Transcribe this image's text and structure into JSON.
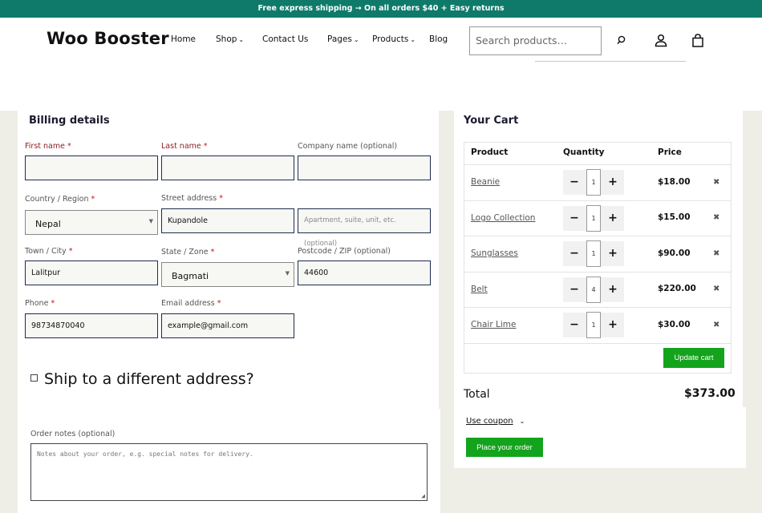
{
  "topbar": {
    "text": "Free express shipping → On all orders $40 + Easy returns"
  },
  "header": {
    "logo": "Woo Booster",
    "nav": [
      {
        "label": "Home",
        "dropdown": false
      },
      {
        "label": "Shop",
        "dropdown": true
      },
      {
        "label": "Contact Us",
        "dropdown": false
      },
      {
        "label": "Pages",
        "dropdown": true
      },
      {
        "label": "Products",
        "dropdown": true
      },
      {
        "label": "Blog",
        "dropdown": false
      }
    ],
    "search_placeholder": "Search products…",
    "icons": [
      "search-icon",
      "user-icon",
      "shopping-bag-icon"
    ]
  },
  "billing": {
    "title": "Billing details",
    "first_name": {
      "label": "First name",
      "value": ""
    },
    "last_name": {
      "label": "Last name",
      "value": ""
    },
    "company": {
      "label": "Company name (optional)",
      "value": ""
    },
    "country": {
      "label": "Country / Region",
      "value": "Nepal"
    },
    "street": {
      "label": "Street address",
      "value": "Kupandole",
      "placeholder2": "Apartment, suite, unit, etc. (optional)"
    },
    "town": {
      "label": "Town / City",
      "value": "Lalitpur"
    },
    "state": {
      "label": "State / Zone",
      "value": "Bagmati"
    },
    "postcode": {
      "label": "Postcode / ZIP (optional)",
      "value": "44600"
    },
    "phone": {
      "label": "Phone",
      "value": "98734870040"
    },
    "email": {
      "label": "Email address",
      "value": "example@gmail.com"
    },
    "required_mark": "*",
    "ship_different": "Ship to a different address?",
    "order_notes": {
      "label": "Order notes (optional)",
      "placeholder": "Notes about your order, e.g. special notes for delivery."
    }
  },
  "cart": {
    "title": "Your Cart",
    "headers": {
      "product": "Product",
      "quantity": "Quantity",
      "price": "Price"
    },
    "items": [
      {
        "name": "Beanie",
        "qty": "1",
        "price": "$18.00"
      },
      {
        "name": "Logo Collection",
        "qty": "1",
        "price": "$15.00"
      },
      {
        "name": "Sunglasses",
        "qty": "1",
        "price": "$90.00"
      },
      {
        "name": "Belt",
        "qty": "4",
        "price": "$220.00"
      },
      {
        "name": "Chair Lime",
        "qty": "1",
        "price": "$30.00"
      }
    ],
    "minus": "−",
    "plus": "+",
    "remove": "✖",
    "update_cart": "Update cart",
    "total_label": "Total",
    "total_value": "$373.00",
    "coupon": "Use coupon",
    "place_order": "Place your order"
  }
}
